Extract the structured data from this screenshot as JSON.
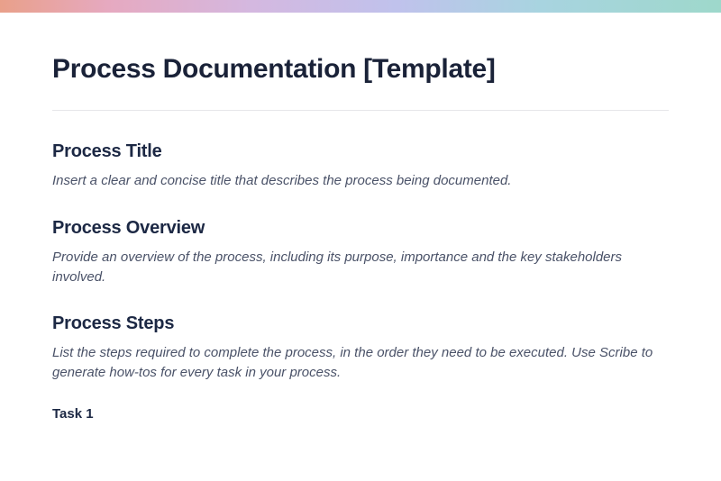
{
  "doc": {
    "title": "Process Documentation [Template]"
  },
  "sections": {
    "title": {
      "heading": "Process Title",
      "body": "Insert a clear and concise title that describes the process being documented."
    },
    "overview": {
      "heading": "Process Overview",
      "body": "Provide an overview of the process, including its purpose, importance and the key stakeholders involved."
    },
    "steps": {
      "heading": "Process Steps",
      "body": "List the steps required to complete the process, in the order they need to be executed. Use Scribe to generate how-tos for every task in your process.",
      "task1": "Task 1"
    }
  }
}
